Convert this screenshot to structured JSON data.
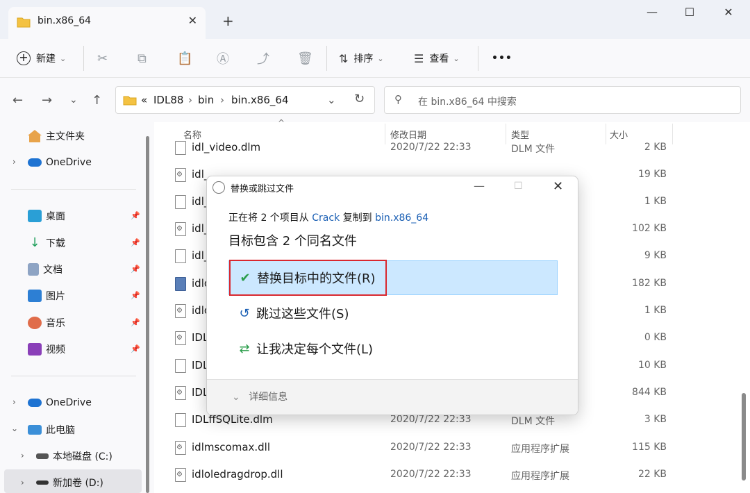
{
  "window": {
    "tab_title": "bin.x86_64",
    "tab_close": "✕",
    "tab_new": "+",
    "minimize": "—",
    "maximize": "☐",
    "close": "✕"
  },
  "toolbar": {
    "new_label": "新建",
    "new_icon": "+",
    "sort_label": "排序",
    "view_label": "查看",
    "more": "•••",
    "caret": "⌄",
    "cut_icon": "✂",
    "copy_icon": "⧉",
    "paste_icon": "📋",
    "rename_icon": "Ⓐ",
    "share_icon": "⤴",
    "delete_icon": "🗑",
    "sort_icon": "⇅",
    "view_icon": "☰"
  },
  "address": {
    "back": "←",
    "forward": "→",
    "recent": "⌄",
    "up": "↑",
    "overflow": "«",
    "crumbs": [
      "IDL88",
      "bin",
      "bin.x86_64"
    ],
    "sep": "›",
    "dropdown": "⌄",
    "refresh": "↻"
  },
  "search": {
    "icon": "⚲",
    "placeholder": "在 bin.x86_64 中搜索"
  },
  "sidebar": {
    "home": "主文件夹",
    "onedrive_top": "OneDrive",
    "pinned": [
      {
        "label": "桌面"
      },
      {
        "label": "下载"
      },
      {
        "label": "文档"
      },
      {
        "label": "图片"
      },
      {
        "label": "音乐"
      },
      {
        "label": "视频"
      }
    ],
    "onedrive": "OneDrive",
    "this_pc": "此电脑",
    "drive_c": "本地磁盘 (C:)",
    "drive_d": "新加卷 (D:)",
    "pin": "📌",
    "chev_right": "›",
    "chev_down": "⌄"
  },
  "columns": {
    "name": "名称",
    "modified": "修改日期",
    "type": "类型",
    "size": "大小",
    "sort_indicator": "^"
  },
  "files": [
    {
      "name": "idl_video.dlm",
      "date": "2020/7/22 22:33",
      "type": "DLM 文件",
      "size": "2 KB",
      "icon": "file"
    },
    {
      "name": "idl_",
      "date": "",
      "type": "",
      "size": "19 KB",
      "icon": "dll"
    },
    {
      "name": "idl_",
      "date": "",
      "type": "",
      "size": "1 KB",
      "icon": "file"
    },
    {
      "name": "idl_",
      "date": "",
      "type": "",
      "size": "102 KB",
      "icon": "dll"
    },
    {
      "name": "idl_",
      "date": "",
      "type": "",
      "size": "9 KB",
      "icon": "file"
    },
    {
      "name": "idlo",
      "date": "",
      "type": "",
      "size": "182 KB",
      "icon": "blue"
    },
    {
      "name": "idlo",
      "date": "",
      "type": "",
      "size": "1 KB",
      "icon": "dll"
    },
    {
      "name": "IDL",
      "date": "",
      "type": "",
      "size": "0 KB",
      "icon": "dll"
    },
    {
      "name": "IDL",
      "date": "",
      "type": "",
      "size": "10 KB",
      "icon": "file"
    },
    {
      "name": "IDL",
      "date": "",
      "type": "",
      "size": "844 KB",
      "icon": "dll"
    },
    {
      "name": "IDLffSQLite.dlm",
      "date": "2020/7/22 22:33",
      "type": "DLM 文件",
      "size": "3 KB",
      "icon": "file"
    },
    {
      "name": "idlmscomax.dll",
      "date": "2020/7/22 22:33",
      "type": "应用程序扩展",
      "size": "115 KB",
      "icon": "dll"
    },
    {
      "name": "idloledragdrop.dll",
      "date": "2020/7/22 22:33",
      "type": "应用程序扩展",
      "size": "22 KB",
      "icon": "dll"
    }
  ],
  "dialog": {
    "title": "替换或跳过文件",
    "minimize": "—",
    "maximize": "☐",
    "close": "✕",
    "desc_prefix": "正在将 2 个项目从 ",
    "source": "Crack",
    "desc_middle": " 复制到 ",
    "dest": "bin.x86_64",
    "heading": "目标包含 2 个同名文件",
    "replace_icon": "✔",
    "replace_label": "替换目标中的文件(R)",
    "skip_icon": "↺",
    "skip_label": "跳过这些文件(S)",
    "decide_icon": "⇄",
    "decide_label": "让我决定每个文件(L)",
    "more_icon": "⌄",
    "more_label": "详细信息"
  },
  "colors": {
    "accent": "#1a5fb4",
    "highlight_box": "#d9272e",
    "selected_option_bg": "#cce8ff"
  }
}
